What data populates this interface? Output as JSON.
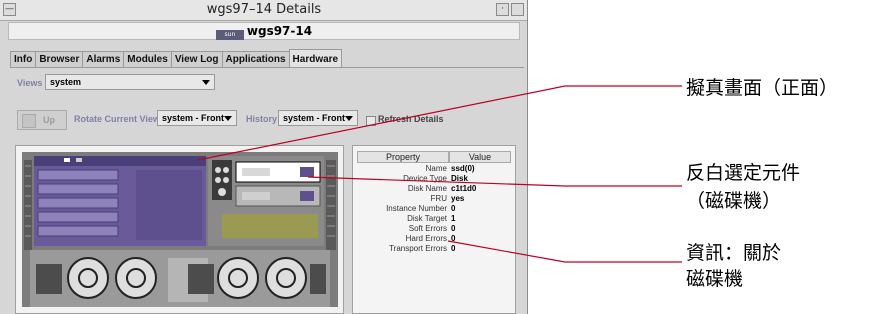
{
  "window": {
    "title": "wgs97–14 Details",
    "host": "wgs97-14",
    "host_icon_label": "sun"
  },
  "tabs": [
    {
      "label": "Info"
    },
    {
      "label": "Browser"
    },
    {
      "label": "Alarms"
    },
    {
      "label": "Modules"
    },
    {
      "label": "View Log"
    },
    {
      "label": "Applications"
    },
    {
      "label": "Hardware",
      "active": true
    }
  ],
  "views": {
    "label": "Views",
    "value": "system"
  },
  "toolbar": {
    "up_label": "Up",
    "rotate_label": "Rotate Current View",
    "rotate_value": "system - Front",
    "history_label": "History",
    "history_value": "system - Front",
    "refresh_label": "Refresh Details",
    "refresh_checked": false
  },
  "properties": {
    "header_property": "Property",
    "header_value": "Value",
    "rows": [
      {
        "name": "Name",
        "value": "ssd(0)"
      },
      {
        "name": "Device Type",
        "value": "Disk"
      },
      {
        "name": "Disk Name",
        "value": "c1t1d0"
      },
      {
        "name": "FRU",
        "value": "yes"
      },
      {
        "name": "Instance Number",
        "value": "0"
      },
      {
        "name": "Disk Target",
        "value": "1"
      },
      {
        "name": "Soft Errors",
        "value": "0"
      },
      {
        "name": "Hard Errors",
        "value": "0"
      },
      {
        "name": "Transport Errors",
        "value": "0"
      }
    ]
  },
  "callouts": {
    "front_view": "擬真畫面（正面）",
    "selected_line1": "反白選定元件",
    "selected_line2": "（磁碟機）",
    "info_line1": "資訊：關於",
    "info_line2": "磁碟機"
  },
  "colors": {
    "chassis_purple": "#6a5a9a",
    "selection_highlight": "#ffffff",
    "window_bg": "#d6d6d6"
  }
}
